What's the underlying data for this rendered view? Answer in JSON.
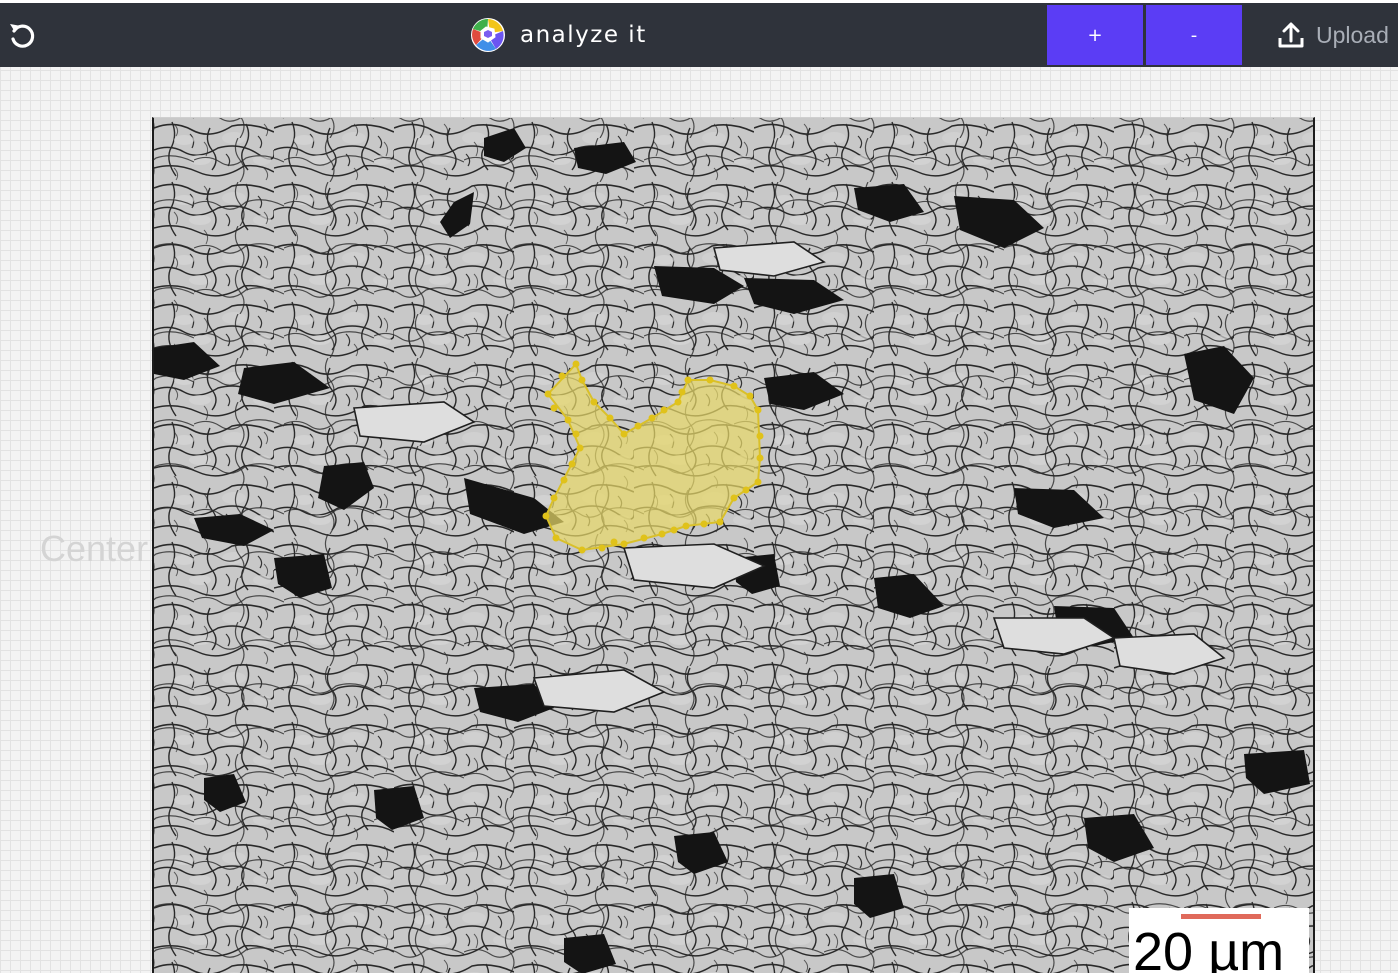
{
  "app": {
    "title": "analyze it",
    "icons": {
      "reset": "undo-icon",
      "logo": "grain-logo-icon",
      "upload": "upload-icon"
    }
  },
  "toolbar": {
    "zoom_in_label": "+",
    "zoom_out_label": "-",
    "upload_label": "Upload"
  },
  "canvas": {
    "background_label": "Center",
    "scale_bar_label": "20 µm",
    "selection_color": "#e8d86a",
    "selection_vertex_color": "#e0c21a"
  },
  "colors": {
    "toolbar_bg": "#2f333b",
    "accent": "#5b3df5",
    "scale_bar_line": "#e06a5b"
  }
}
